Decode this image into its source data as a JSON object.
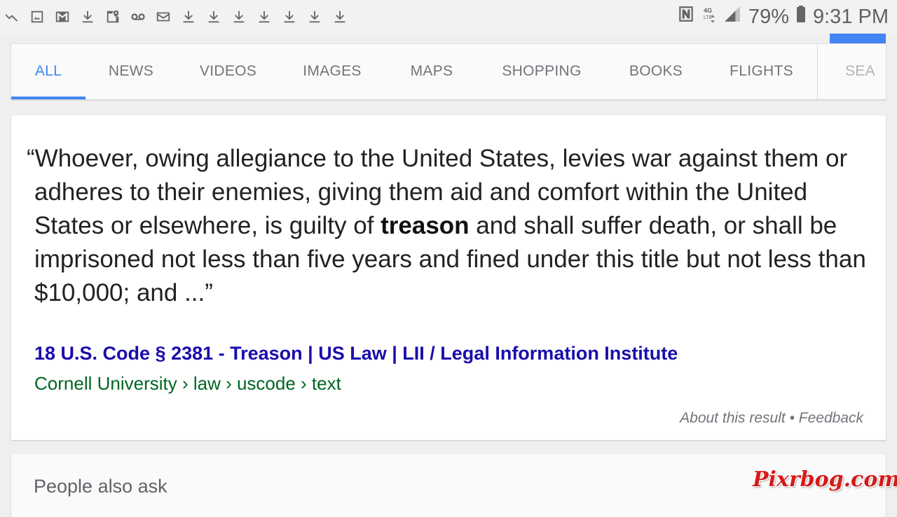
{
  "status_bar": {
    "left_icons": [
      "missed-call-icon",
      "image-icon",
      "gmail-icon",
      "download-icon",
      "maps-icon",
      "voicemail-icon",
      "email-icon",
      "download-icon",
      "download-icon",
      "download-icon",
      "download-icon",
      "download-icon",
      "download-icon",
      "download-icon"
    ],
    "right_icons": [
      "nfc-icon",
      "4g-lte-icon",
      "signal-icon"
    ],
    "battery": "79%",
    "time": "9:31 PM"
  },
  "tabs": [
    "ALL",
    "NEWS",
    "VIDEOS",
    "IMAGES",
    "MAPS",
    "SHOPPING",
    "BOOKS",
    "FLIGHTS",
    "SEA"
  ],
  "active_tab": "ALL",
  "result": {
    "quote_before": "“Whoever, owing allegiance to the United States, levies war against them or adheres to their enemies, giving them aid and comfort within the United States or elsewhere, is guilty of ",
    "quote_bold": "treason",
    "quote_after": " and shall suffer death, or shall be imprisoned not less than five years and fined under this title but not less than $10,000; and ...”",
    "title": "18 U.S. Code § 2381 - Treason | US Law | LII / Legal Information Institute",
    "breadcrumb": "Cornell University › law › uscode › text",
    "about_link": "About this result",
    "separator": " • ",
    "feedback_link": "Feedback"
  },
  "people_also_ask": {
    "title": "People also ask"
  },
  "watermark": "Pixrbog.com",
  "colors": {
    "accent": "#4285f4",
    "link": "#1a0dab",
    "url": "#006621"
  }
}
